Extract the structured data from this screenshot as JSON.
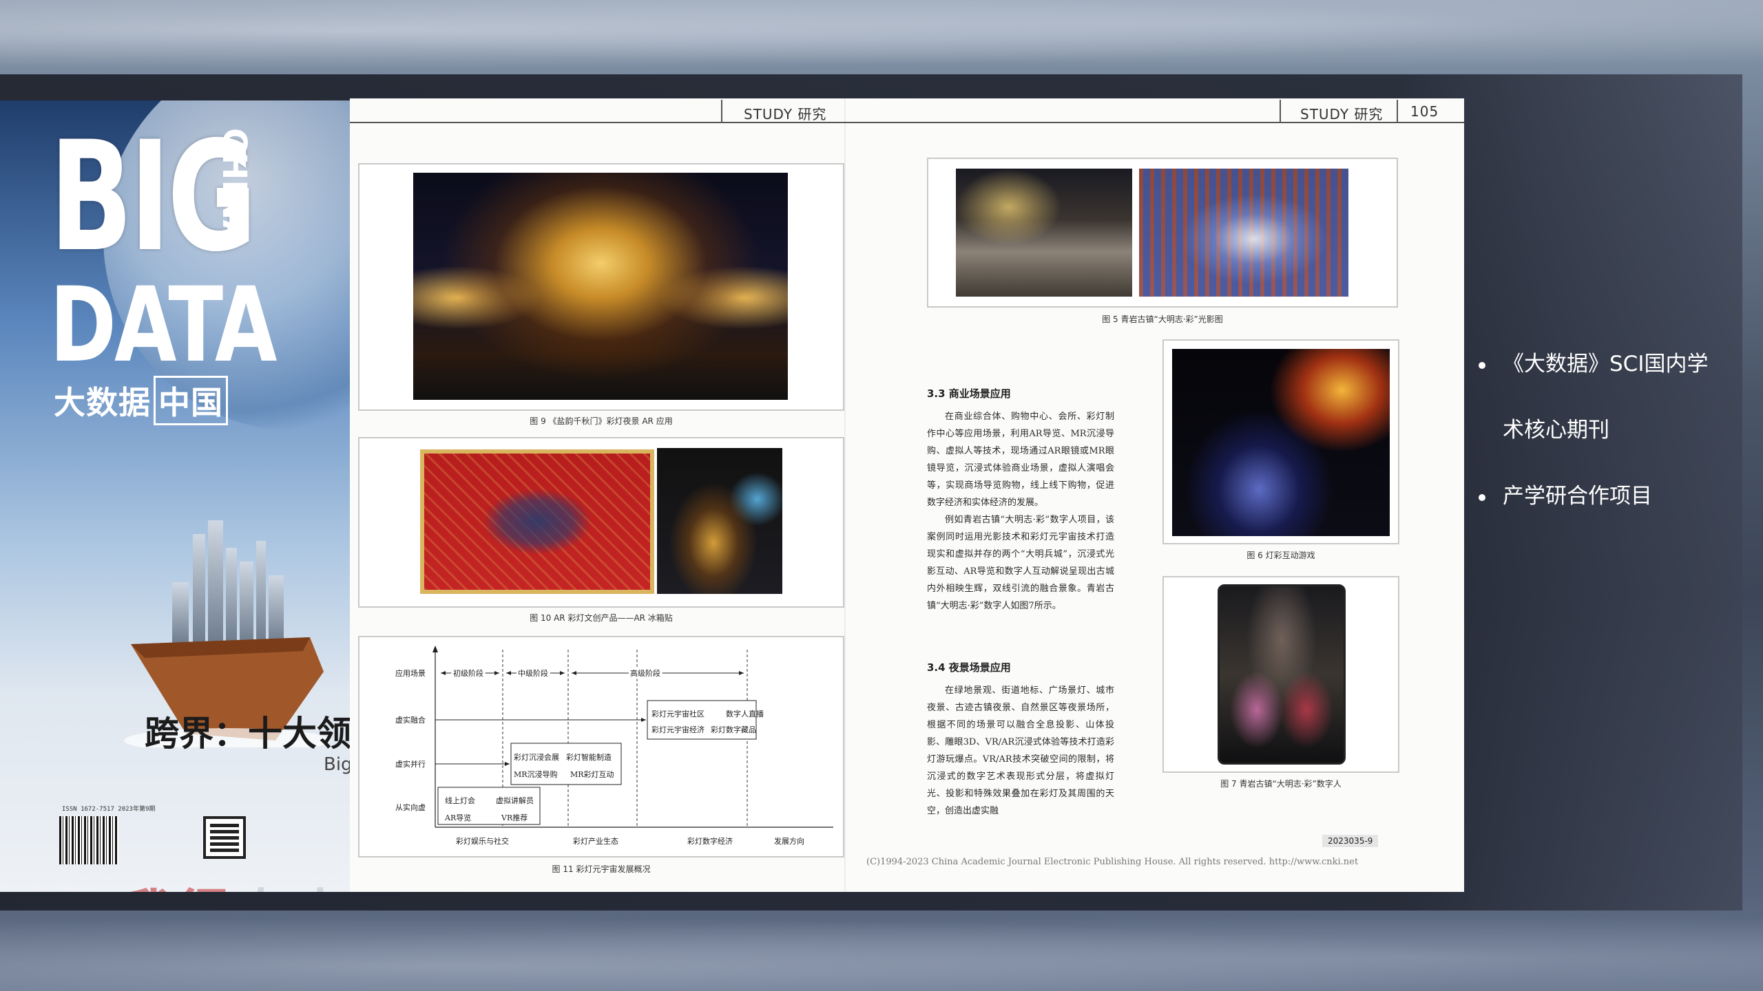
{
  "cover": {
    "big": "BIG",
    "data": "DATA",
    "china": "CHINA",
    "cn_title_a": "大数据",
    "cn_title_b": "中国",
    "headline": "跨界：十大领域",
    "sub": "Big",
    "issn": "ISSN 1672-7517  2023年第9期",
    "stamp": "我得",
    "stamp_faint": "杂志"
  },
  "left_page": {
    "header": "STUDY  研究",
    "fig9_caption": "图 9  《盐韵千秋门》彩灯夜景 AR 应用",
    "fig10_caption": "图 10  AR 彩灯文创产品——AR 冰箱贴",
    "fig11_caption": "图 11  彩灯元宇宙发展概况",
    "diagram": {
      "y_labels": [
        "应用场景",
        "虚实融合",
        "虚实并行",
        "从实向虚"
      ],
      "stages": [
        "初级阶段",
        "中级阶段",
        "高级阶段"
      ],
      "x_labels": [
        "彩灯娱乐与社交",
        "彩灯产业生态",
        "彩灯数字经济",
        "发展方向"
      ],
      "box1": [
        "线上灯会",
        "虚拟讲解员",
        "AR导览",
        "VR推荐"
      ],
      "box2": [
        "彩灯沉浸会展",
        "彩灯智能制造",
        "MR沉浸导购",
        "MR彩灯互动"
      ],
      "box3": [
        "彩灯元宇宙社区",
        "数字人直播",
        "彩灯元宇宙经济",
        "彩灯数字藏品"
      ]
    }
  },
  "right_page": {
    "header": "STUDY  研究",
    "page_number": "105",
    "fig5_caption": "图 5  青岩古镇“大明志·彩”光影图",
    "fig6_caption": "图 6  灯彩互动游戏",
    "fig7_caption": "图 7  青岩古镇“大明志·彩”数字人",
    "sec33_title": "3.3  商业场景应用",
    "sec33_p1": "在商业综合体、购物中心、会所、彩灯制作中心等应用场景，利用AR导览、MR沉浸导购、虚拟人等技术，现场通过AR眼镜或MR眼镜导览，沉浸式体验商业场景，虚拟人演唱会等，实现商场导览购物，线上线下购物，促进数字经济和实体经济的发展。",
    "sec33_p2": "例如青岩古镇“大明志·彩”数字人项目，该案例同时运用光影技术和彩灯元宇宙技术打造现实和虚拟并存的两个“大明兵城”，沉浸式光影互动、AR导览和数字人互动解说呈现出古城内外相映生辉，双线引流的融合景象。青岩古镇“大明志·彩”数字人如图7所示。",
    "sec34_title": "3.4  夜景场景应用",
    "sec34_p1": "在绿地景观、街道地标、广场景灯、城市夜景、古迹古镇夜景、自然景区等夜景场所，根据不同的场景可以融合全息投影、山体投影、雕眼3D、VR/AR沉浸式体验等技术打造彩灯游玩爆点。VR/AR技术突破空间的限制，将沉浸式的数字艺术表现形式分层，将虚拟灯光、投影和特殊效果叠加在彩灯及其周围的天空，创造出虚实融",
    "page_code": "2023035-9",
    "footer": "(C)1994-2023 China Academic Journal Electronic Publishing House. All rights reserved.    http://www.cnki.net"
  },
  "bullets": [
    {
      "line1": "《大数据》SCI国内学",
      "line2": "术核心期刊"
    },
    {
      "line1": "产学研合作项目",
      "line2": ""
    }
  ]
}
